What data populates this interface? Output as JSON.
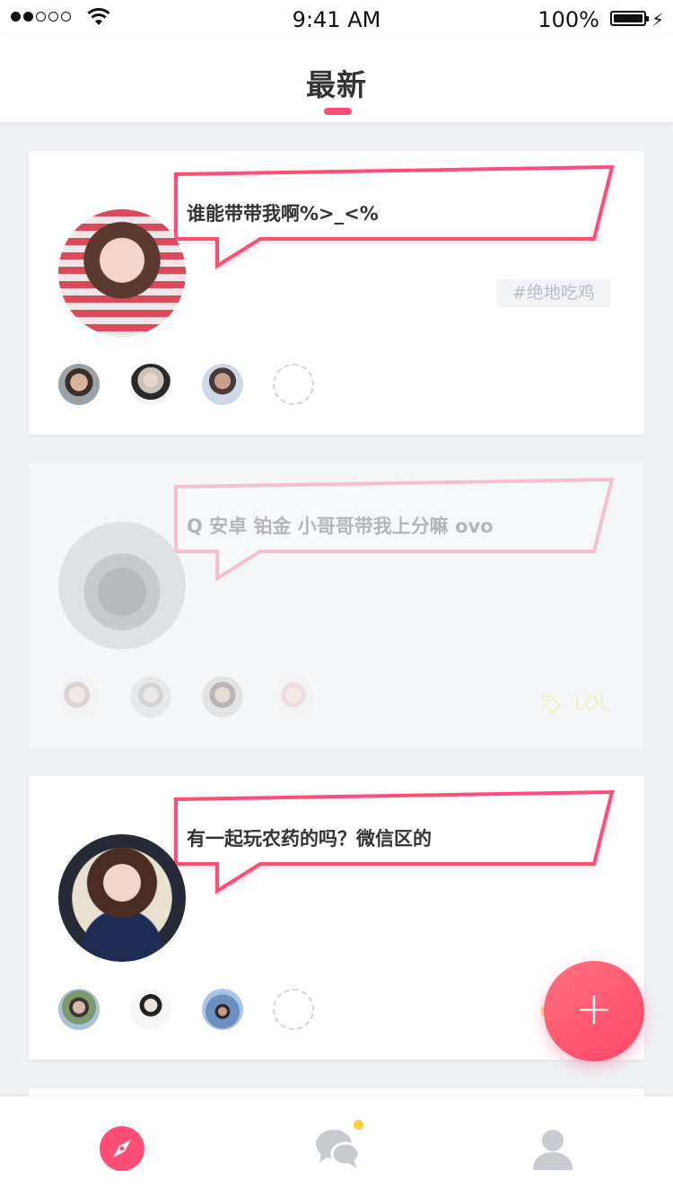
{
  "status_bar": {
    "time": "9:41 AM",
    "battery": "100%",
    "signal_icon": "signal-dots-icon",
    "wifi_icon": "wifi-icon",
    "battery_icon": "battery-icon",
    "charging_icon": "bolt-icon"
  },
  "header": {
    "title": "最新",
    "indicator_color": "#ff4d76"
  },
  "posts": [
    {
      "message": "谁能带带我啊%>_<%",
      "tag": "#绝地吃鸡",
      "members": 3,
      "empty_slots": 1
    },
    {
      "message": "Q 安卓 铂金 小哥哥带我上分嘛 ovo",
      "game": "LOL",
      "members": 4,
      "empty_slots": 0
    },
    {
      "message": "有一起玩农药的吗？微信区的",
      "members": 3,
      "empty_slots": 1
    }
  ],
  "fab": {
    "label": "+",
    "icon": "plus-icon"
  },
  "tabbar": {
    "tabs": [
      {
        "name": "discover",
        "icon": "compass-icon",
        "active": true
      },
      {
        "name": "messages",
        "icon": "chat-bubbles-icon",
        "badge": true
      },
      {
        "name": "profile",
        "icon": "person-icon"
      }
    ]
  },
  "colors": {
    "accent": "#ff4d76",
    "badge": "#f7cf39",
    "background": "#eef1f4"
  }
}
